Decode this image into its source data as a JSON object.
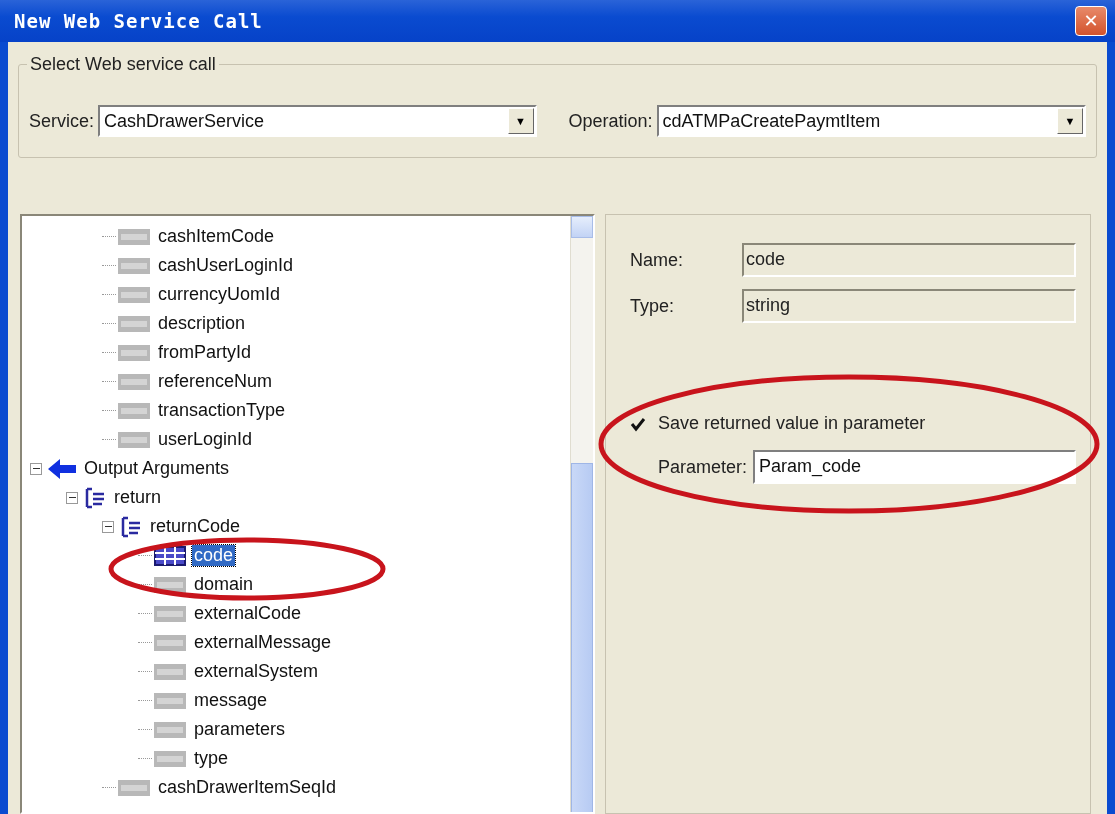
{
  "window": {
    "title": "New Web Service Call",
    "close": "✕"
  },
  "call_group": {
    "legend": "Select Web service call",
    "fields": [
      {
        "label": "Service:",
        "value": "CashDrawerService",
        "arrow": "▼"
      },
      {
        "label": "Operation:",
        "value": "cdATMPaCreatePaymtItem",
        "arrow": "▼"
      }
    ]
  },
  "tree": {
    "nodes": [
      {
        "children": [
          {
            "children": [
              {
                "label": "cashItemCode",
                "kind": "string",
                "selected": false
              },
              {
                "label": "cashUserLoginId",
                "kind": "string",
                "selected": false
              },
              {
                "label": "currencyUomId",
                "kind": "string",
                "selected": false
              },
              {
                "label": "description",
                "kind": "string",
                "selected": false
              },
              {
                "label": "fromPartyId",
                "kind": "string",
                "selected": false
              },
              {
                "label": "referenceNum",
                "kind": "string",
                "selected": false
              },
              {
                "label": "transactionType",
                "kind": "string",
                "selected": false
              },
              {
                "label": "userLoginId",
                "kind": "string",
                "selected": false
              }
            ]
          }
        ]
      },
      {
        "label": "Output Arguments",
        "kind": "output",
        "expanded": true,
        "selected": false,
        "children": [
          {
            "label": "return",
            "kind": "struct",
            "expanded": true,
            "selected": false,
            "children": [
              {
                "label": "returnCode",
                "kind": "struct",
                "expanded": true,
                "selected": false,
                "children": [
                  {
                    "label": "code",
                    "kind": "table",
                    "selected": true
                  },
                  {
                    "label": "domain",
                    "kind": "string",
                    "selected": false
                  },
                  {
                    "label": "externalCode",
                    "kind": "string",
                    "selected": false
                  },
                  {
                    "label": "externalMessage",
                    "kind": "string",
                    "selected": false
                  },
                  {
                    "label": "externalSystem",
                    "kind": "string",
                    "selected": false
                  },
                  {
                    "label": "message",
                    "kind": "string",
                    "selected": false
                  },
                  {
                    "label": "parameters",
                    "kind": "string",
                    "selected": false
                  },
                  {
                    "label": "type",
                    "kind": "string",
                    "selected": false
                  }
                ]
              },
              {
                "label": "cashDrawerItemSeqId",
                "kind": "string",
                "selected": false
              }
            ]
          }
        ]
      }
    ]
  },
  "details": {
    "fields": [
      {
        "label": "Name:",
        "value": "code"
      },
      {
        "label": "Type:",
        "value": "string"
      }
    ],
    "save_option": {
      "label": "Save returned value in parameter",
      "checked": true
    },
    "parameter": {
      "label": "Parameter:",
      "value": "Param_code"
    }
  },
  "annotations": [
    {
      "kind": "ellipse"
    },
    {
      "kind": "ellipse"
    }
  ]
}
